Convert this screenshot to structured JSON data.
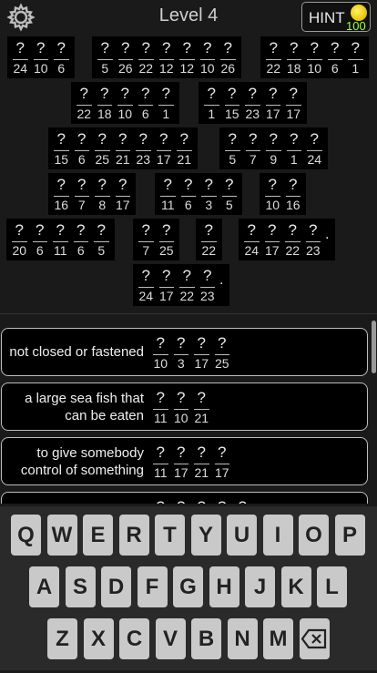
{
  "header": {
    "title": "Level 4",
    "hint_label": "HINT",
    "hint_count": "100",
    "settings_icon": "gear-icon",
    "coin_icon": "coin-icon",
    "coin_color": "#f5d800",
    "count_color": "#9aff3d"
  },
  "puzzle": {
    "placeholder": "?",
    "words": [
      {
        "nums": [
          "24",
          "10",
          "6"
        ]
      },
      {
        "nums": [
          "5",
          "26",
          "22",
          "12",
          "12",
          "10",
          "26"
        ]
      },
      {
        "nums": [
          "22",
          "18",
          "10",
          "6",
          "1"
        ]
      },
      {
        "nums": [
          "22",
          "18",
          "10",
          "6",
          "1"
        ]
      },
      {
        "nums": [
          "1",
          "15",
          "23",
          "17",
          "17"
        ]
      },
      {
        "nums": [
          "15",
          "6",
          "25",
          "21",
          "23",
          "17",
          "21"
        ]
      },
      {
        "nums": [
          "5",
          "7",
          "9",
          "1",
          "24"
        ]
      },
      {
        "nums": [
          "16",
          "7",
          "8",
          "17"
        ]
      },
      {
        "nums": [
          "11",
          "6",
          "3",
          "5"
        ]
      },
      {
        "nums": [
          "10",
          "16"
        ]
      },
      {
        "nums": [
          "20",
          "6",
          "11",
          "6",
          "5"
        ]
      },
      {
        "nums": [
          "7",
          "25"
        ]
      },
      {
        "nums": [
          "22"
        ]
      },
      {
        "nums": [
          "24",
          "17",
          "22",
          "23"
        ],
        "punct": "."
      },
      {
        "nums": [
          "24",
          "17",
          "22",
          "23"
        ],
        "punct": "."
      }
    ]
  },
  "clues": [
    {
      "text": "not closed or fastened",
      "nums": [
        "10",
        "3",
        "17",
        "25"
      ]
    },
    {
      "text": "a large sea fish that can be eaten",
      "nums": [
        "11",
        "10",
        "21"
      ]
    },
    {
      "text": "to give somebody control of something",
      "nums": [
        "11",
        "17",
        "21",
        "17"
      ]
    },
    {
      "text": "",
      "nums": [
        "",
        "",
        "",
        "",
        ""
      ]
    }
  ],
  "keyboard": {
    "rows": [
      [
        "Q",
        "W",
        "E",
        "R",
        "T",
        "Y",
        "U",
        "I",
        "O",
        "P"
      ],
      [
        "A",
        "S",
        "D",
        "F",
        "G",
        "H",
        "J",
        "K",
        "L"
      ],
      [
        "Z",
        "X",
        "C",
        "V",
        "B",
        "N",
        "M"
      ]
    ],
    "backspace_icon": "backspace-icon"
  }
}
